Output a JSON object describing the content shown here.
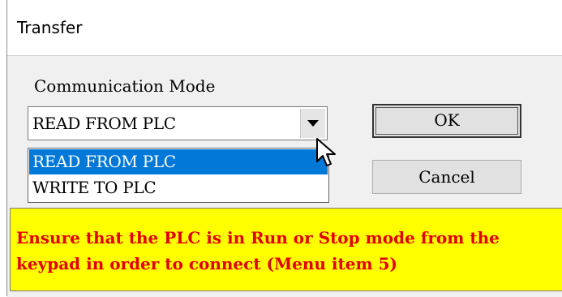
{
  "window": {
    "title": "Transfer"
  },
  "form": {
    "group_label": "Communication Mode",
    "combo": {
      "selected": "READ FROM PLC",
      "options": [
        "READ FROM PLC",
        "WRITE TO PLC"
      ]
    },
    "buttons": {
      "ok": "OK",
      "cancel": "Cancel"
    }
  },
  "banner": {
    "message": "Ensure that the PLC is in Run or Stop mode from the keypad in order to connect (Menu item 5)"
  },
  "icons": {
    "dropdown_arrow": "chevron-down-icon",
    "mouse_cursor": "mouse-pointer-icon"
  },
  "colors": {
    "selection": "#0078d7",
    "banner_background": "#ffff00",
    "banner_text": "#e00000"
  }
}
